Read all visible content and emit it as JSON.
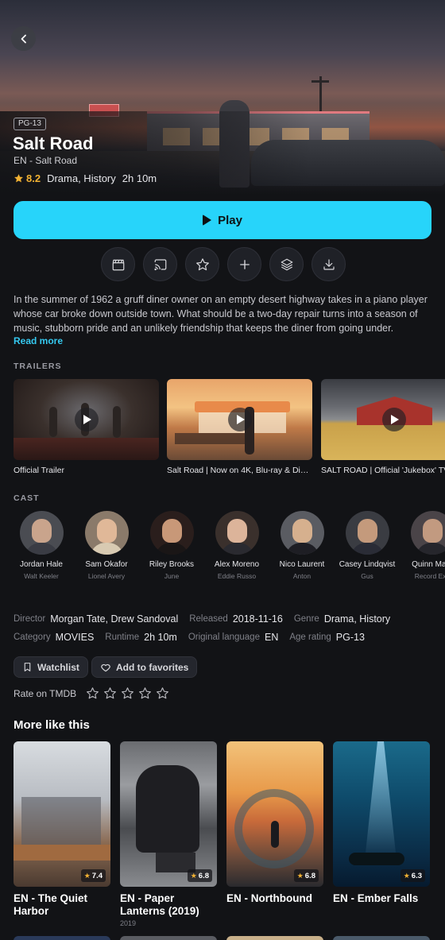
{
  "hero": {
    "rating": "PG-13",
    "title": "Salt Road",
    "subtitle": "EN - Salt Road",
    "score": "8.2",
    "genres": "Drama, History",
    "duration": "2h 10m"
  },
  "actions": {
    "play_label": "Play",
    "icons": [
      "clapperboard-icon",
      "cast-icon",
      "star-icon",
      "plus-icon",
      "layers-icon",
      "download-icon"
    ]
  },
  "description": {
    "text": "In the summer of 1962 a gruff diner owner on an empty desert highway takes in a piano player whose car broke down outside town. What should be a two-day repair turns into a season of music, stubborn pride and an unlikely friendship that keeps the diner from going under.",
    "read_more": "Read more"
  },
  "trailers": {
    "heading": "TRAILERS",
    "items": [
      {
        "caption": "Official Trailer"
      },
      {
        "caption": "Salt Road | Now on 4K, Blu-ray & Digit..."
      },
      {
        "caption": "SALT ROAD | Official 'Jukebox' TV"
      }
    ]
  },
  "cast": {
    "heading": "CAST",
    "items": [
      {
        "name": "Jordan Hale",
        "role": "Walt Keeler"
      },
      {
        "name": "Sam Okafor",
        "role": "Lionel Avery"
      },
      {
        "name": "Riley Brooks",
        "role": "June"
      },
      {
        "name": "Alex Moreno",
        "role": "Eddie Russo"
      },
      {
        "name": "Nico Laurent",
        "role": "Anton"
      },
      {
        "name": "Casey Lindqvist",
        "role": "Gus"
      },
      {
        "name": "Quinn Mark",
        "role": "Record Exe"
      }
    ]
  },
  "details": {
    "director_label": "Director",
    "director": "Morgan Tate, Drew Sandoval",
    "released_label": "Released",
    "released": "2018-11-16",
    "genre_label": "Genre",
    "genre": "Drama, History",
    "category_label": "Category",
    "category": "MOVIES",
    "runtime_label": "Runtime",
    "runtime": "2h 10m",
    "language_label": "Original language",
    "language": "EN",
    "age_label": "Age rating",
    "age": "PG-13"
  },
  "buttons": {
    "watchlist": "Watchlist",
    "favorites": "Add to favorites",
    "rate_label": "Rate on TMDB"
  },
  "more": {
    "heading": "More like this",
    "items": [
      {
        "title": "EN - The Quiet Harbor",
        "rating": "7.4",
        "year": ""
      },
      {
        "title": "EN - Paper Lanterns (2019)",
        "rating": "6.8",
        "year": "2019"
      },
      {
        "title": "EN - Northbound",
        "rating": "6.8",
        "year": ""
      },
      {
        "title": "EN - Ember Falls",
        "rating": "6.3",
        "year": ""
      }
    ]
  },
  "colors": {
    "accent": "#27d4fa",
    "link": "#35c9f0",
    "star": "#f2b233",
    "background": "#121316"
  }
}
